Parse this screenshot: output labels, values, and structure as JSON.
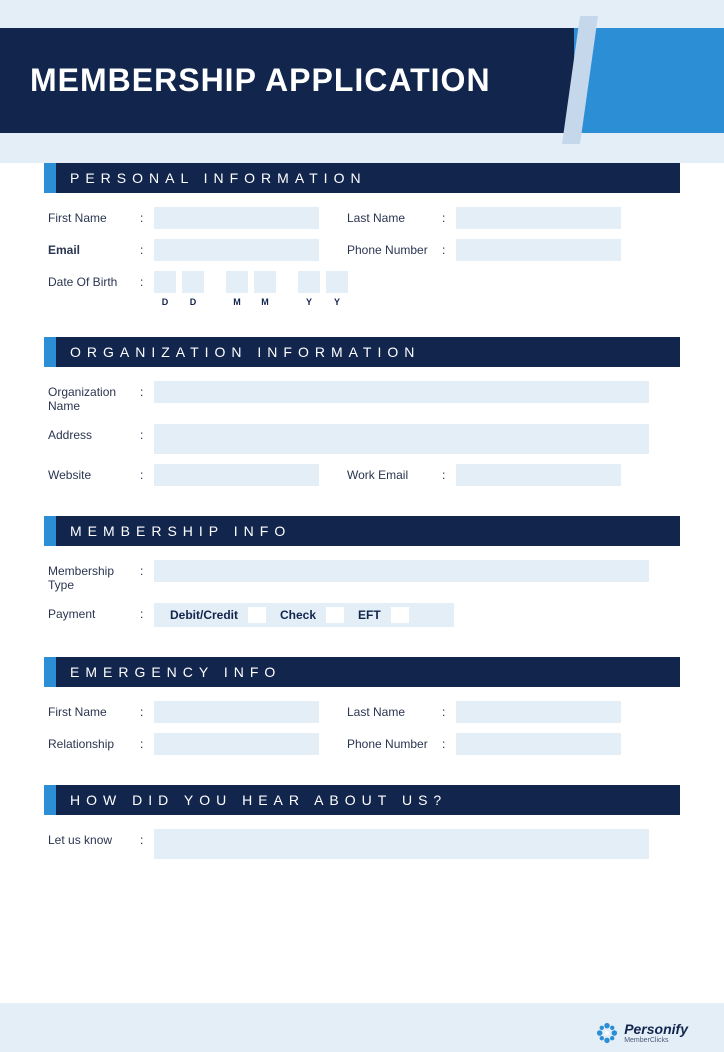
{
  "banner": {
    "title": "MEMBERSHIP APPLICATION"
  },
  "sections": {
    "personal": {
      "title": "PERSONAL INFORMATION",
      "first_name_label": "First Name",
      "last_name_label": "Last Name",
      "email_label": "Email",
      "phone_label": "Phone Number",
      "dob_label": "Date Of Birth",
      "dob_codes": [
        "D",
        "D",
        "M",
        "M",
        "Y",
        "Y"
      ]
    },
    "org": {
      "title": "ORGANIZATION INFORMATION",
      "org_name_label": "Organization Name",
      "address_label": "Address",
      "website_label": "Website",
      "work_email_label": "Work Email"
    },
    "membership": {
      "title": "MEMBERSHIP INFO",
      "type_label": "Membership Type",
      "payment_label": "Payment",
      "options": {
        "debit": "Debit/Credit",
        "check": "Check",
        "eft": "EFT"
      }
    },
    "emergency": {
      "title": "EMERGENCY INFO",
      "first_name_label": "First Name",
      "last_name_label": "Last Name",
      "relationship_label": "Relationship",
      "phone_label": "Phone Number"
    },
    "hear": {
      "title": "HOW DID YOU HEAR ABOUT US?",
      "let_us_know_label": "Let us know"
    }
  },
  "colon": ":",
  "logo": {
    "name": "Personify",
    "sub": "MemberClicks"
  }
}
